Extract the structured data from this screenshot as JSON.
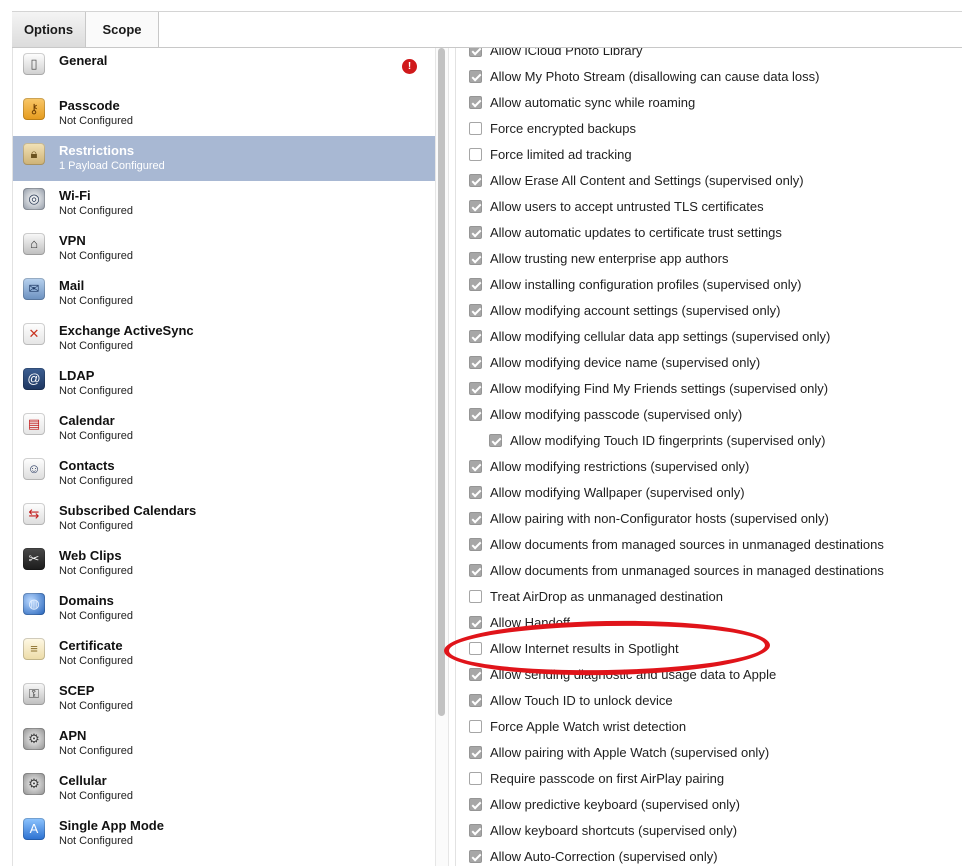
{
  "tabs": [
    {
      "label": "Options",
      "active": true
    },
    {
      "label": "Scope",
      "active": false
    }
  ],
  "sidebar": {
    "items": [
      {
        "title": "General",
        "subtitle": "",
        "icon": "switch-icon",
        "alert": "!"
      },
      {
        "title": "Passcode",
        "subtitle": "Not Configured",
        "icon": "key-icon"
      },
      {
        "title": "Restrictions",
        "subtitle": "1 Payload Configured",
        "icon": "lock-icon",
        "selected": true
      },
      {
        "title": "Wi-Fi",
        "subtitle": "Not Configured",
        "icon": "wifi-icon"
      },
      {
        "title": "VPN",
        "subtitle": "Not Configured",
        "icon": "vpn-lock-icon"
      },
      {
        "title": "Mail",
        "subtitle": "Not Configured",
        "icon": "stamp-icon"
      },
      {
        "title": "Exchange ActiveSync",
        "subtitle": "Not Configured",
        "icon": "exchange-icon"
      },
      {
        "title": "LDAP",
        "subtitle": "Not Configured",
        "icon": "address-book-icon"
      },
      {
        "title": "Calendar",
        "subtitle": "Not Configured",
        "icon": "calendar-icon"
      },
      {
        "title": "Contacts",
        "subtitle": "Not Configured",
        "icon": "contacts-icon"
      },
      {
        "title": "Subscribed Calendars",
        "subtitle": "Not Configured",
        "icon": "subscribed-calendar-icon"
      },
      {
        "title": "Web Clips",
        "subtitle": "Not Configured",
        "icon": "scissors-icon"
      },
      {
        "title": "Domains",
        "subtitle": "Not Configured",
        "icon": "globe-icon"
      },
      {
        "title": "Certificate",
        "subtitle": "Not Configured",
        "icon": "certificate-icon"
      },
      {
        "title": "SCEP",
        "subtitle": "Not Configured",
        "icon": "scep-lock-icon"
      },
      {
        "title": "APN",
        "subtitle": "Not Configured",
        "icon": "gear-icon"
      },
      {
        "title": "Cellular",
        "subtitle": "Not Configured",
        "icon": "gear-icon"
      },
      {
        "title": "Single App Mode",
        "subtitle": "Not Configured",
        "icon": "app-store-icon"
      }
    ]
  },
  "restrictions": [
    {
      "label": "Allow iCloud Photo Library",
      "checked": true,
      "indent": 0
    },
    {
      "label": "Allow My Photo Stream (disallowing can cause data loss)",
      "checked": true,
      "indent": 0
    },
    {
      "label": "Allow automatic sync while roaming",
      "checked": true,
      "indent": 0
    },
    {
      "label": "Force encrypted backups",
      "checked": false,
      "indent": 0
    },
    {
      "label": "Force limited ad tracking",
      "checked": false,
      "indent": 0
    },
    {
      "label": "Allow Erase All Content and Settings (supervised only)",
      "checked": true,
      "indent": 0
    },
    {
      "label": "Allow users to accept untrusted TLS certificates",
      "checked": true,
      "indent": 0
    },
    {
      "label": "Allow automatic updates to certificate trust settings",
      "checked": true,
      "indent": 0
    },
    {
      "label": "Allow trusting new enterprise app authors",
      "checked": true,
      "indent": 0
    },
    {
      "label": "Allow installing configuration profiles (supervised only)",
      "checked": true,
      "indent": 0
    },
    {
      "label": "Allow modifying account settings (supervised only)",
      "checked": true,
      "indent": 0
    },
    {
      "label": "Allow modifying cellular data app settings (supervised only)",
      "checked": true,
      "indent": 0
    },
    {
      "label": "Allow modifying device name (supervised only)",
      "checked": true,
      "indent": 0
    },
    {
      "label": "Allow modifying Find My Friends settings (supervised only)",
      "checked": true,
      "indent": 0
    },
    {
      "label": "Allow modifying passcode (supervised only)",
      "checked": true,
      "indent": 0
    },
    {
      "label": "Allow modifying Touch ID fingerprints (supervised only)",
      "checked": true,
      "indent": 1
    },
    {
      "label": "Allow modifying restrictions (supervised only)",
      "checked": true,
      "indent": 0
    },
    {
      "label": "Allow modifying Wallpaper (supervised only)",
      "checked": true,
      "indent": 0
    },
    {
      "label": "Allow pairing with non-Configurator hosts (supervised only)",
      "checked": true,
      "indent": 0
    },
    {
      "label": "Allow documents from managed sources in unmanaged destinations",
      "checked": true,
      "indent": 0
    },
    {
      "label": "Allow documents from unmanaged sources in managed destinations",
      "checked": true,
      "indent": 0
    },
    {
      "label": "Treat AirDrop as unmanaged destination",
      "checked": false,
      "indent": 0
    },
    {
      "label": "Allow Handoff",
      "checked": true,
      "indent": 0
    },
    {
      "label": "Allow Internet results in Spotlight",
      "checked": false,
      "indent": 0
    },
    {
      "label": "Allow sending diagnostic and usage data to Apple",
      "checked": true,
      "indent": 0
    },
    {
      "label": "Allow Touch ID to unlock device",
      "checked": true,
      "indent": 0
    },
    {
      "label": "Force Apple Watch wrist detection",
      "checked": false,
      "indent": 0
    },
    {
      "label": "Allow pairing with Apple Watch (supervised only)",
      "checked": true,
      "indent": 0
    },
    {
      "label": "Require passcode on first AirPlay pairing",
      "checked": false,
      "indent": 0
    },
    {
      "label": "Allow predictive keyboard (supervised only)",
      "checked": true,
      "indent": 0
    },
    {
      "label": "Allow keyboard shortcuts (supervised only)",
      "checked": true,
      "indent": 0
    },
    {
      "label": "Allow Auto-Correction (supervised only)",
      "checked": true,
      "indent": 0
    }
  ],
  "colors": {
    "selected_row": "#a8b8d3",
    "checkbox_checked": "#a7a7a7",
    "annotation_ring": "#e0141a",
    "alert_badge": "#d0191b"
  }
}
